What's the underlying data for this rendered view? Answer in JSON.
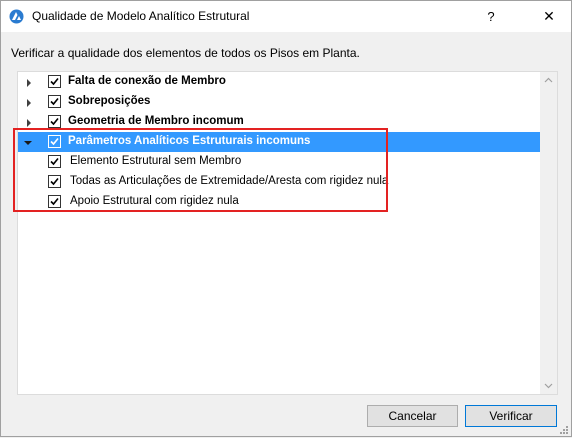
{
  "window": {
    "title": "Qualidade de Modelo Analítico Estrutural",
    "help_label": "?",
    "close_label": "✕",
    "app_icon": "archicad-icon"
  },
  "description": "Verificar a qualidade dos elementos de todos os Pisos em Planta.",
  "tree": {
    "items": [
      {
        "label": "Falta de conexão de Membro",
        "checked": true,
        "expanded": false,
        "bold": true
      },
      {
        "label": "Sobreposições",
        "checked": true,
        "expanded": false,
        "bold": true
      },
      {
        "label": "Geometria de Membro incomum",
        "checked": true,
        "expanded": false,
        "bold": true
      },
      {
        "label": "Parâmetros Analíticos Estruturais incomuns",
        "checked": true,
        "expanded": true,
        "bold": true,
        "selected": true,
        "children": [
          {
            "label": "Elemento Estrutural sem Membro",
            "checked": true
          },
          {
            "label": "Todas as Articulações de Extremidade/Aresta com rigidez nula",
            "checked": true
          },
          {
            "label": "Apoio Estrutural com rigidez nula",
            "checked": true
          }
        ]
      }
    ]
  },
  "buttons": {
    "cancel_label": "Cancelar",
    "verify_label": "Verificar"
  },
  "colors": {
    "selection": "#3399ff",
    "highlight_border": "#e32222",
    "default_button_border": "#0078d7"
  }
}
